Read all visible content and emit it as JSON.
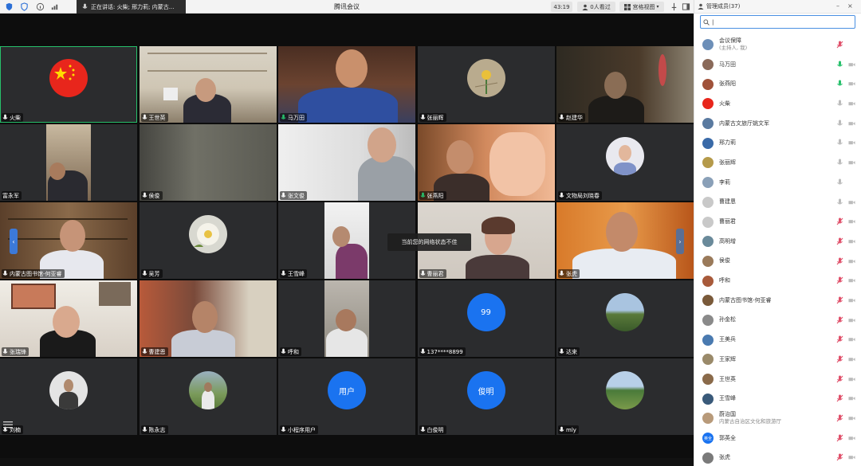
{
  "titlebar": {
    "speaking": "正在讲话: 火柴; 邢力莉; 内蒙古...",
    "title": "腾讯会议",
    "timer": "43:19",
    "people": "0人看过",
    "view": "宫格视图"
  },
  "toast": "当前您的网络状态不佳",
  "tiles": [
    {
      "name": "火柴"
    },
    {
      "name": "王世英"
    },
    {
      "name": "马万田"
    },
    {
      "name": "张丽辉"
    },
    {
      "name": "赵建华"
    },
    {
      "name": "富永军"
    },
    {
      "name": "侯俊"
    },
    {
      "name": "张文俊"
    },
    {
      "name": "张燕阳"
    },
    {
      "name": "文物局刘晓春"
    },
    {
      "name": "内蒙古图书馆-何亚睿"
    },
    {
      "name": "吴芳"
    },
    {
      "name": "王雪峰"
    },
    {
      "name": "曹丽君"
    },
    {
      "name": "张虎"
    },
    {
      "name": "张瑞锋"
    },
    {
      "name": "曹建恩"
    },
    {
      "name": "呼和"
    },
    {
      "name": "137****8899",
      "avatar_text": "99"
    },
    {
      "name": "达来"
    },
    {
      "name": "刘楠"
    },
    {
      "name": "陈永志"
    },
    {
      "name": "小程序用户",
      "avatar_text": "用户"
    },
    {
      "name": "白俊明",
      "avatar_text": "俊明"
    },
    {
      "name": "mly"
    }
  ],
  "panel": {
    "title": "管理成员(37)",
    "search_placeholder": "",
    "members": [
      {
        "name": "会议保障",
        "sub": "(主持人, 我)"
      },
      {
        "name": "马万田"
      },
      {
        "name": "张燕阳"
      },
      {
        "name": "火柴"
      },
      {
        "name": "内蒙古文旅厅姚文军"
      },
      {
        "name": "邢力莉"
      },
      {
        "name": "张丽辉"
      },
      {
        "name": "李莉"
      },
      {
        "name": "曹建恩"
      },
      {
        "name": "曹丽君"
      },
      {
        "name": "高明增"
      },
      {
        "name": "侯俊"
      },
      {
        "name": "呼和"
      },
      {
        "name": "内蒙古图书馆-何亚睿"
      },
      {
        "name": "孙金松"
      },
      {
        "name": "王美兵"
      },
      {
        "name": "王家辉"
      },
      {
        "name": "王世英"
      },
      {
        "name": "王雪峰"
      },
      {
        "name": "蔚治国",
        "sub": "内蒙古自治区文化和旅游厅"
      },
      {
        "name": "郭英全",
        "avatar_text": "英全"
      },
      {
        "name": "张虎"
      }
    ]
  },
  "colors": {
    "accent": "#1a73f0",
    "active": "#27c06b",
    "muted": "#e0506a"
  }
}
